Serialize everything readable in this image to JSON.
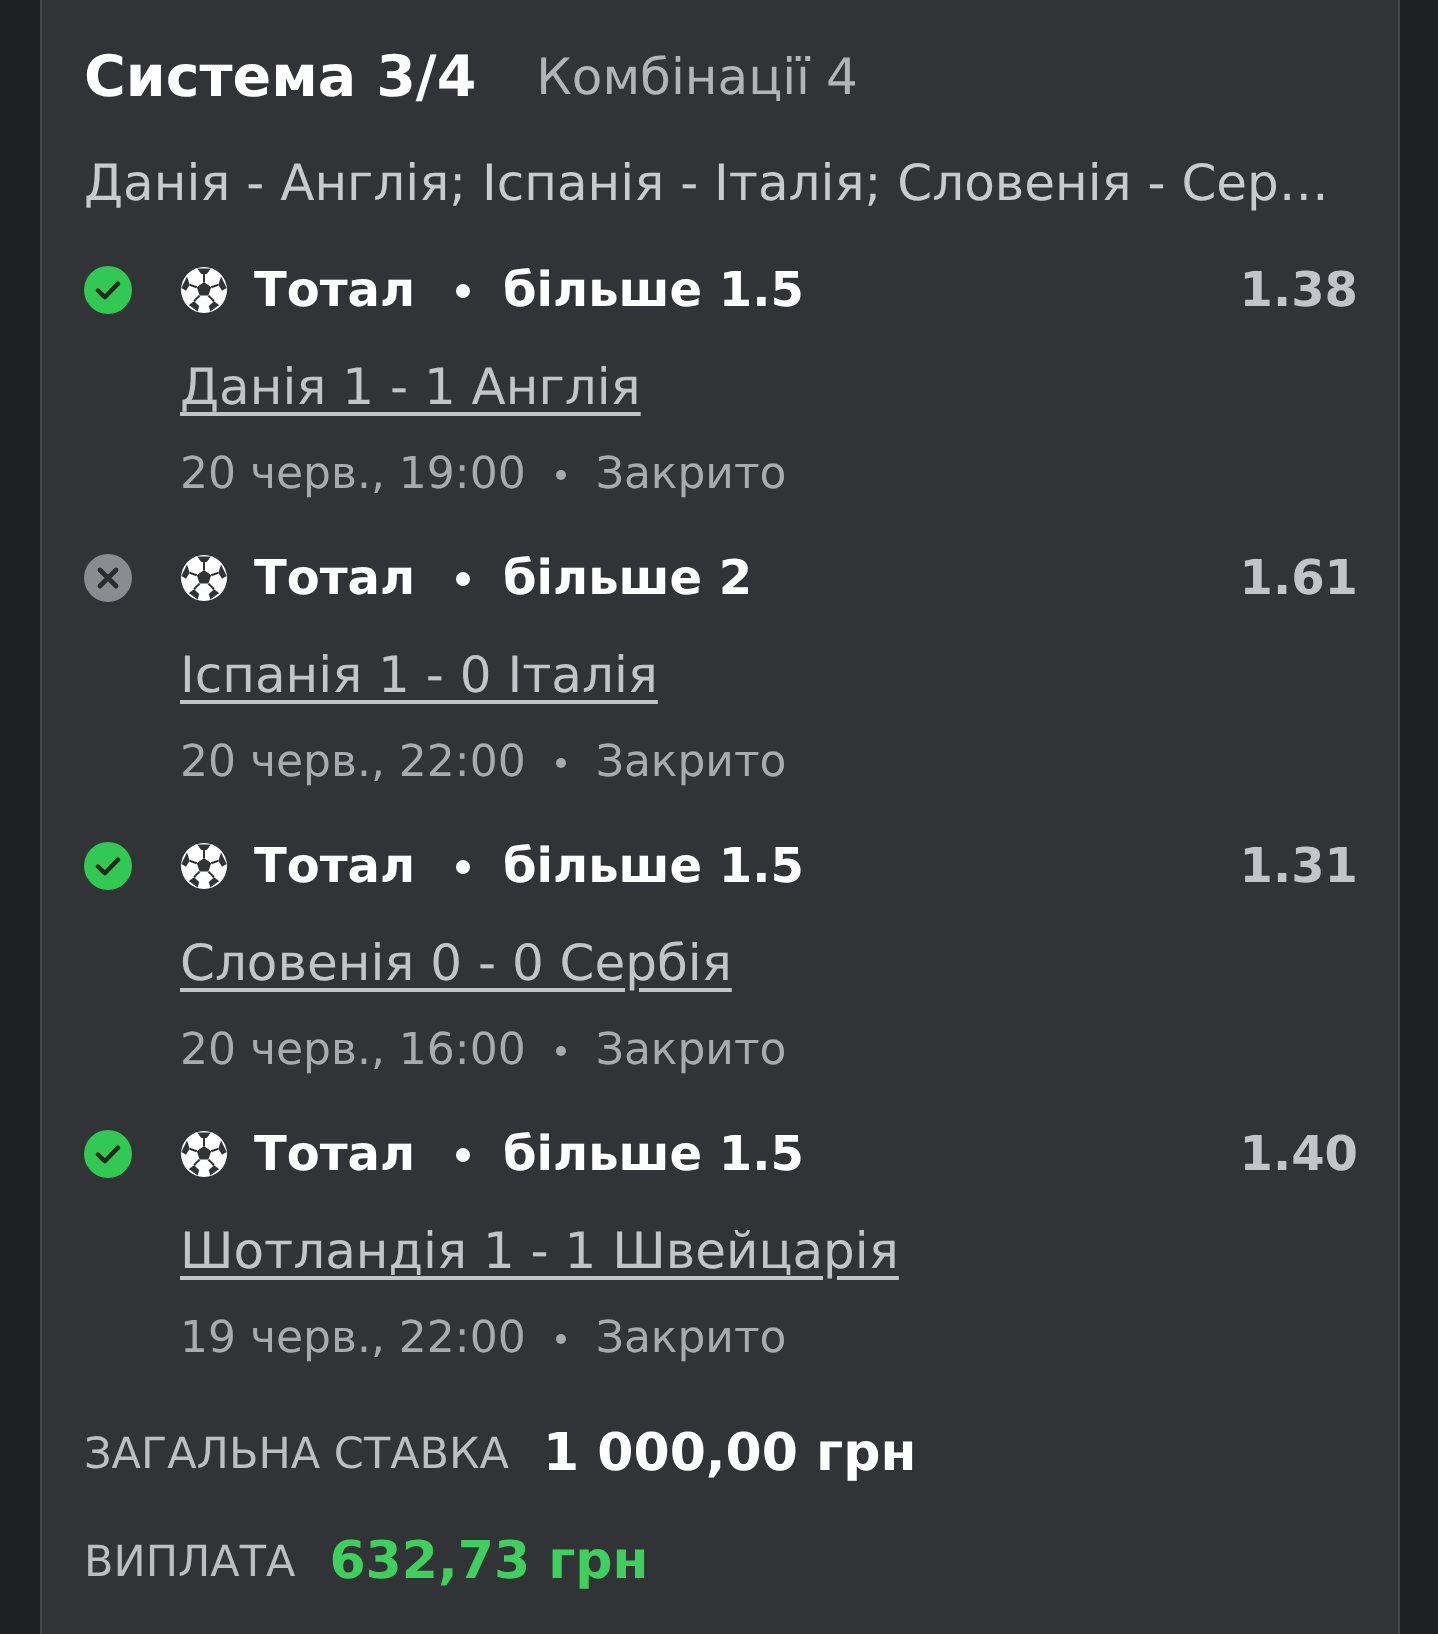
{
  "bet": {
    "title": "Система 3/4",
    "combinations": "Комбінації 4",
    "events_summary": "Данія - Англія; Іспанія - Італія; Словенія - Сер…"
  },
  "selections": [
    {
      "won": true,
      "market": "Тотал",
      "outcome": "більше 1.5",
      "odds": "1.38",
      "match": "Данія 1 - 1 Англія",
      "date": "20 черв., 19:00",
      "status": "Закрито"
    },
    {
      "won": false,
      "market": "Тотал",
      "outcome": "більше 2",
      "odds": "1.61",
      "match": "Іспанія 1 - 0 Італія",
      "date": "20 черв., 22:00",
      "status": "Закрито"
    },
    {
      "won": true,
      "market": "Тотал",
      "outcome": "більше 1.5",
      "odds": "1.31",
      "match": "Словенія 0 - 0 Сербія",
      "date": "20 черв., 16:00",
      "status": "Закрито"
    },
    {
      "won": true,
      "market": "Тотал",
      "outcome": "більше 1.5",
      "odds": "1.40",
      "match": "Шотландія 1 - 1 Швейцарія",
      "date": "19 черв., 22:00",
      "status": "Закрито"
    }
  ],
  "summary": {
    "stake_label": "ЗАГАЛЬНА СТАВКА",
    "stake": "1 000,00 грн",
    "payout_label": "ВИПЛАТА",
    "payout": "632,73 грн"
  }
}
